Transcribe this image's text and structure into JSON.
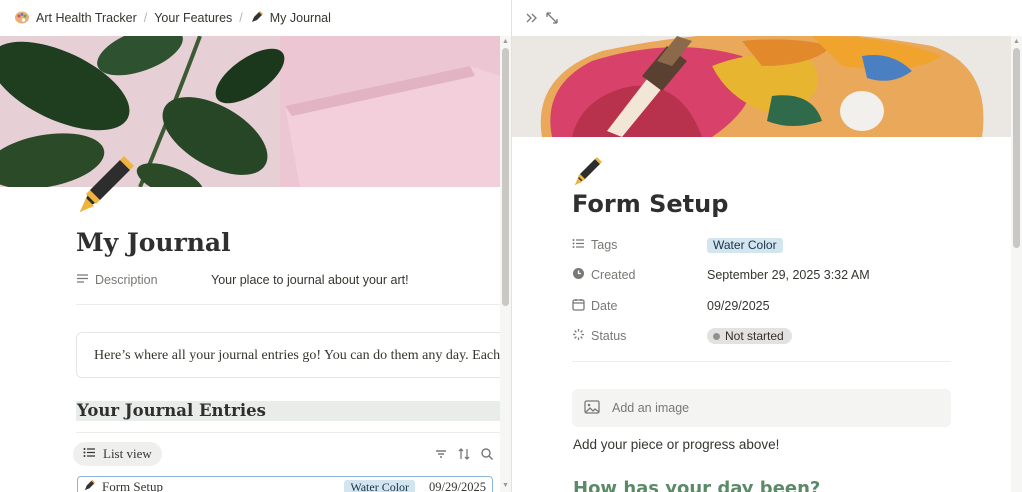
{
  "breadcrumbs": [
    {
      "label": "Art Health Tracker",
      "icon": "palette-icon"
    },
    {
      "label": "Your Features"
    },
    {
      "label": "My Journal",
      "icon": "fountain-pen-icon"
    }
  ],
  "journal": {
    "title": "My Journal",
    "description_label": "Description",
    "description_value": "Your place to journal about your art!",
    "callout_text": "Here’s where all your journal entries go! You can do them any day. Each asks a",
    "section_heading": "Your Journal Entries",
    "view_label": "List view",
    "entries": [
      {
        "title": "Form Setup",
        "tag": "Water Color",
        "date": "09/29/2025"
      }
    ]
  },
  "peek": {
    "title": "Form Setup",
    "properties": {
      "tags_label": "Tags",
      "tags_value": "Water Color",
      "created_label": "Created",
      "created_value": "September 29, 2025 3:32 AM",
      "date_label": "Date",
      "date_value": "09/29/2025",
      "status_label": "Status",
      "status_value": "Not started"
    },
    "add_image_label": "Add an image",
    "body_text": "Add your piece or progress above!",
    "heading": "How has your day been?"
  },
  "colors": {
    "tag_blue_bg": "#d3e5ef",
    "heading_green": "#5c8a68",
    "section_heading_bg": "#e8ede9",
    "status_pill_bg": "#e3e2e0"
  }
}
